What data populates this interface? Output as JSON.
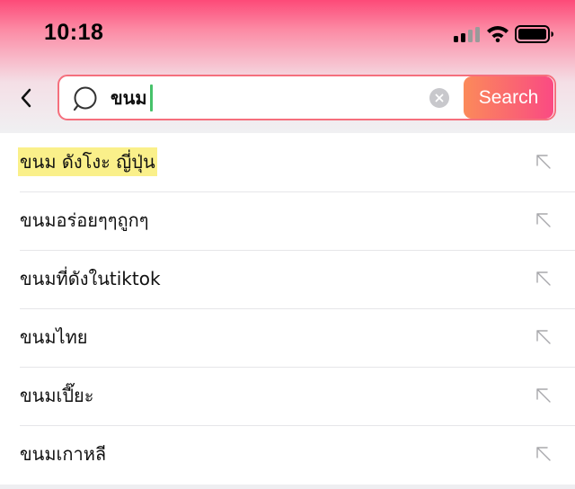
{
  "status_bar": {
    "time": "10:18",
    "icons": [
      "signal-icon",
      "wifi-icon",
      "battery-icon"
    ]
  },
  "colors": {
    "header_top": "#fd4a78",
    "search_border": "#f56f7d",
    "search_button_start": "#fb8a5a",
    "search_button_end": "#fa4a83",
    "caret": "#46c26a",
    "highlight": "#faf08a"
  },
  "search": {
    "value": "ขนม",
    "button_label": "Search"
  },
  "suggestions": [
    {
      "label": "ขนม ดังโงะ ญี่ปุ่น",
      "highlighted": true
    },
    {
      "label": "ขนมอร่อยๆๆถูกๆ",
      "highlighted": false
    },
    {
      "label": "ขนมที่ดังในtiktok",
      "highlighted": false
    },
    {
      "label": "ขนมไทย",
      "highlighted": false
    },
    {
      "label": "ขนมเปี๊ยะ",
      "highlighted": false
    },
    {
      "label": "ขนมเกาหลี",
      "highlighted": false
    }
  ]
}
